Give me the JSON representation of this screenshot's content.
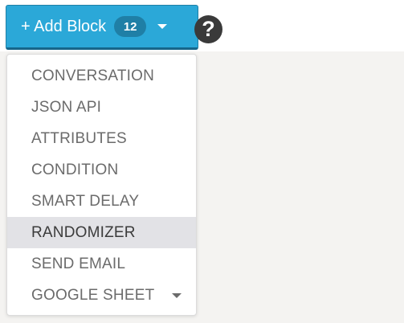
{
  "add_block": {
    "label": "+ Add Block",
    "count": "12"
  },
  "help": {
    "icon": "question-circle-icon",
    "symbol": "?"
  },
  "menu": {
    "items": [
      {
        "label": "CONVERSATION"
      },
      {
        "label": "JSON API"
      },
      {
        "label": "ATTRIBUTES"
      },
      {
        "label": "CONDITION"
      },
      {
        "label": "SMART DELAY"
      },
      {
        "label": "RANDOMIZER",
        "selected": true
      },
      {
        "label": "SEND EMAIL"
      },
      {
        "label": "GOOGLE SHEET",
        "has_submenu": true
      }
    ]
  },
  "colors": {
    "button": "#2ba8d8",
    "badge": "#1f7fa6",
    "selected_item": "#e2e2e6",
    "canvas": "#f4f3f1"
  }
}
